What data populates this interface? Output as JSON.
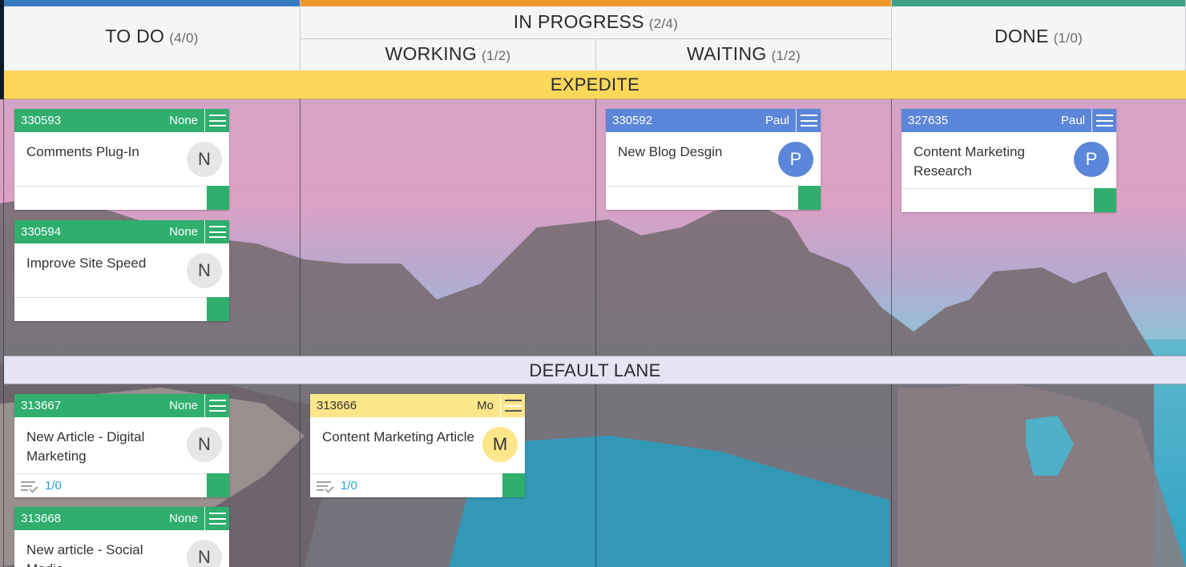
{
  "columns": {
    "todo": {
      "title": "TO DO",
      "count": "(4/0)"
    },
    "in_progress": {
      "title": "IN PROGRESS",
      "count": "(2/4)"
    },
    "working": {
      "title": "WORKING",
      "count": "(1/2)"
    },
    "waiting": {
      "title": "WAITING",
      "count": "(1/2)"
    },
    "done": {
      "title": "DONE",
      "count": "(1/0)"
    }
  },
  "lanes": {
    "expedite": "EXPEDITE",
    "default": "DEFAULT LANE"
  },
  "colors": {
    "green": "#2fae6e",
    "blue": "#5b86d9",
    "yellow": "#fde68a",
    "todo_bar": "#3b7bc4",
    "progress_bar": "#f0962d",
    "done_bar": "#3fa086"
  },
  "cards": [
    {
      "id": "330593",
      "owner": "None",
      "title": "Comments Plug-In",
      "avatar": "N",
      "checklist": ""
    },
    {
      "id": "330594",
      "owner": "None",
      "title": "Improve Site Speed",
      "avatar": "N",
      "checklist": ""
    },
    {
      "id": "330592",
      "owner": "Paul",
      "title": "New Blog Desgin",
      "avatar": "P",
      "checklist": ""
    },
    {
      "id": "327635",
      "owner": "Paul",
      "title": "Content Marketing Research",
      "avatar": "P",
      "checklist": ""
    },
    {
      "id": "313667",
      "owner": "None",
      "title": "New Article - Digital Marketing",
      "avatar": "N",
      "checklist": "1/0"
    },
    {
      "id": "313666",
      "owner": "Mo",
      "title": "Content Marketing Article",
      "avatar": "M",
      "checklist": "1/0"
    },
    {
      "id": "313668",
      "owner": "None",
      "title": "New article - Social Media",
      "avatar": "N",
      "checklist": ""
    }
  ]
}
